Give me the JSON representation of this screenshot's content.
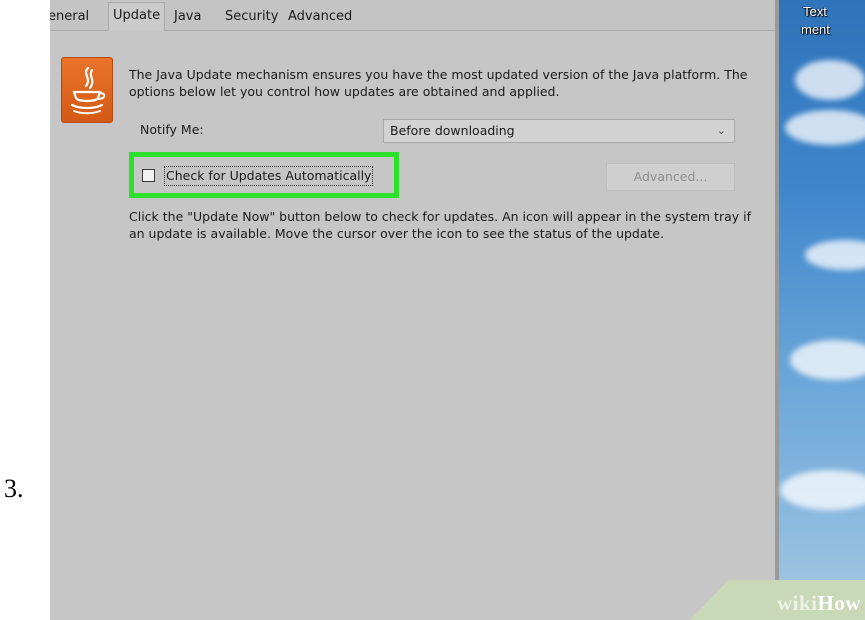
{
  "step": {
    "number": "3."
  },
  "tabs": [
    {
      "label": "eneral",
      "active": false
    },
    {
      "label": "Update",
      "active": true
    },
    {
      "label": "Java",
      "active": false
    },
    {
      "label": "Security",
      "active": false
    },
    {
      "label": "Advanced",
      "active": false
    }
  ],
  "update_panel": {
    "icon": "java-coffee-cup-icon",
    "description": "The Java Update mechanism ensures you have the most updated version of the Java platform. The options below let you control how updates are obtained and applied.",
    "notify_label": "Notify Me:",
    "notify_value": "Before downloading",
    "auto_check_label": "Check for Updates Automatically",
    "auto_check_checked": false,
    "advanced_button": "Advanced...",
    "advanced_enabled": false,
    "info_text": "Click the \"Update Now\" button below to check for updates. An icon will appear in the system tray if an update is available. Move the cursor over the icon to see the status of the update."
  },
  "desktop": {
    "labels": [
      "Text",
      "ment"
    ]
  },
  "highlight_color": "#2be12b",
  "watermark": {
    "wiki": "wiki",
    "how": "How"
  }
}
